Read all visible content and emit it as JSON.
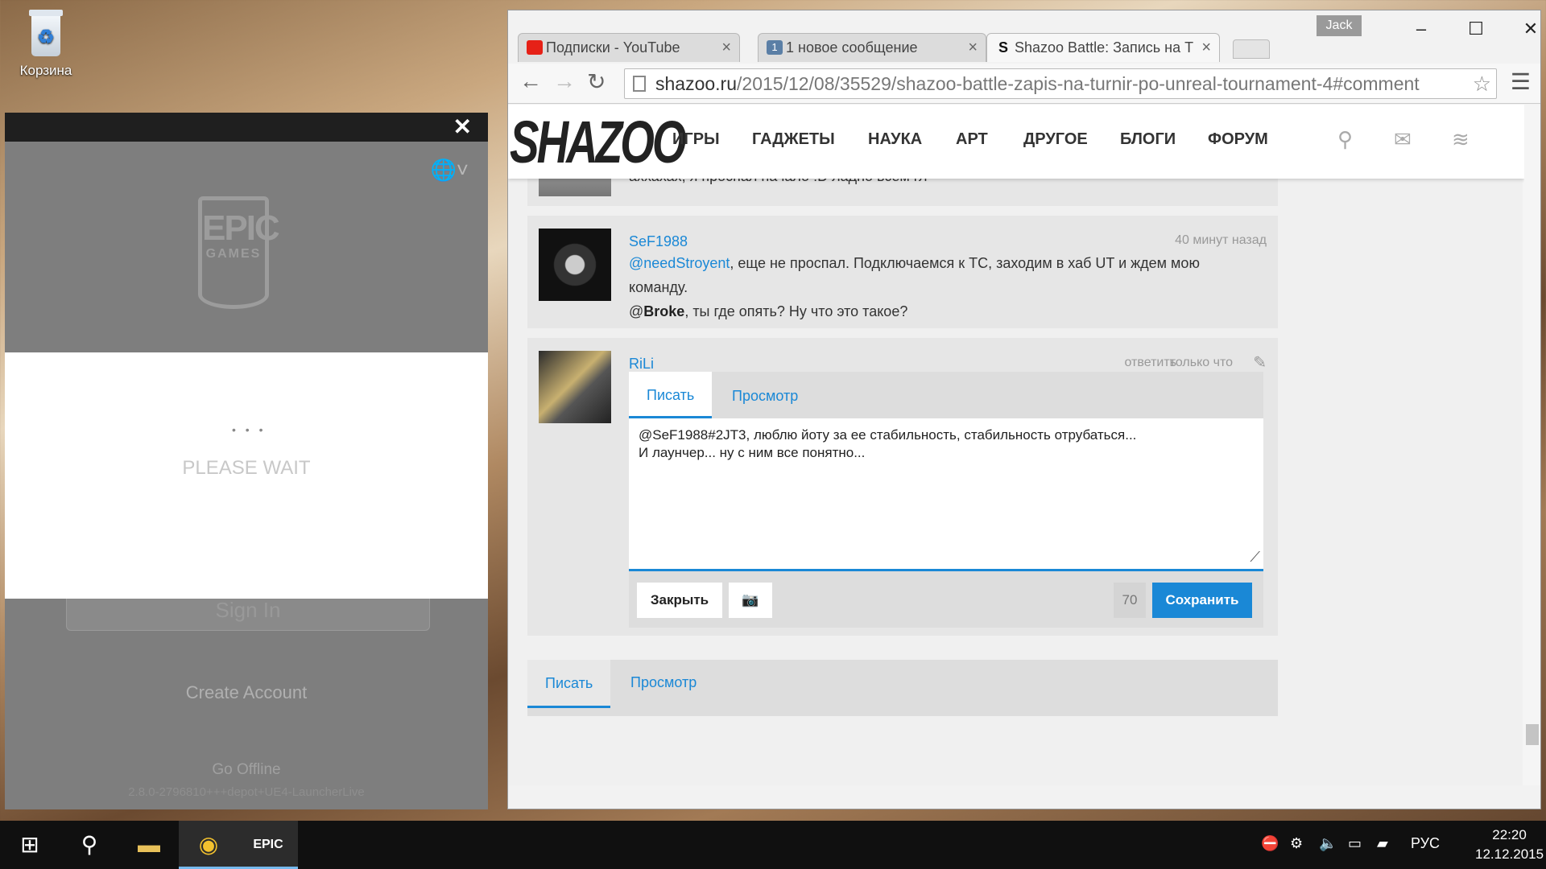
{
  "desktop": {
    "recycle_label": "Корзина"
  },
  "epic": {
    "close": "✕",
    "please_wait": "PLEASE WAIT",
    "sign_in": "Sign In",
    "create_account": "Create Account",
    "go_offline": "Go Offline",
    "version": "2.8.0-2796810+++depot+UE4-LauncherLive",
    "logo_top": "EPIC",
    "logo_bottom": "GAMES"
  },
  "browser": {
    "user": "Jack",
    "tabs": [
      {
        "title": "Подписки - YouTube",
        "fav_color": "#e62117"
      },
      {
        "title": "1 новое сообщение",
        "fav_badge": "1",
        "fav_color": "#5b7fa6"
      },
      {
        "title": "Shazoo Battle: Запись на Т",
        "fav_badge": "S"
      }
    ],
    "url_host": "shazoo.ru",
    "url_path": "/2015/12/08/35529/shazoo-battle-zapis-na-turnir-po-unreal-tournament-4#comment"
  },
  "site": {
    "brand": "SHAZOO",
    "nav": [
      "ИГРЫ",
      "ГАДЖЕТЫ",
      "НАУКА",
      "АРТ",
      "ДРУГОЕ",
      "БЛОГИ",
      "ФОРУМ"
    ]
  },
  "comments": [
    {
      "text": "аххахах, я проспал начало :D ладно всем гл"
    },
    {
      "author": "SeF1988",
      "time": "40 минут назад",
      "mention1": "@needStroyent",
      "line1_rest": ", еще не проспал. Подключаемся к ТС, заходим в хаб UT и ждем мою",
      "line2": "команду.",
      "at": "@",
      "mention2": "Broke",
      "line3_rest": ", ты где опять? Ну что это такое?"
    },
    {
      "author": "RiLi",
      "reply": "ответить",
      "time": "только что"
    }
  ],
  "editor": {
    "tab_write": "Писать",
    "tab_preview": "Просмотр",
    "line1": "@SeF1988#2JT3, люблю йоту за ее стабильность, стабильность отрубаться...",
    "line2": "И лаунчер... ну с ним все понятно...",
    "close_btn": "Закрыть",
    "counter": "70",
    "save_btn": "Сохранить"
  },
  "bottom_editor": {
    "tab_write": "Писать",
    "tab_preview": "Просмотр"
  },
  "taskbar": {
    "lang": "РУС",
    "time": "22:20",
    "date": "12.12.2015"
  },
  "colors": {
    "accent": "#1a88d6",
    "taskbar": "#101010"
  }
}
